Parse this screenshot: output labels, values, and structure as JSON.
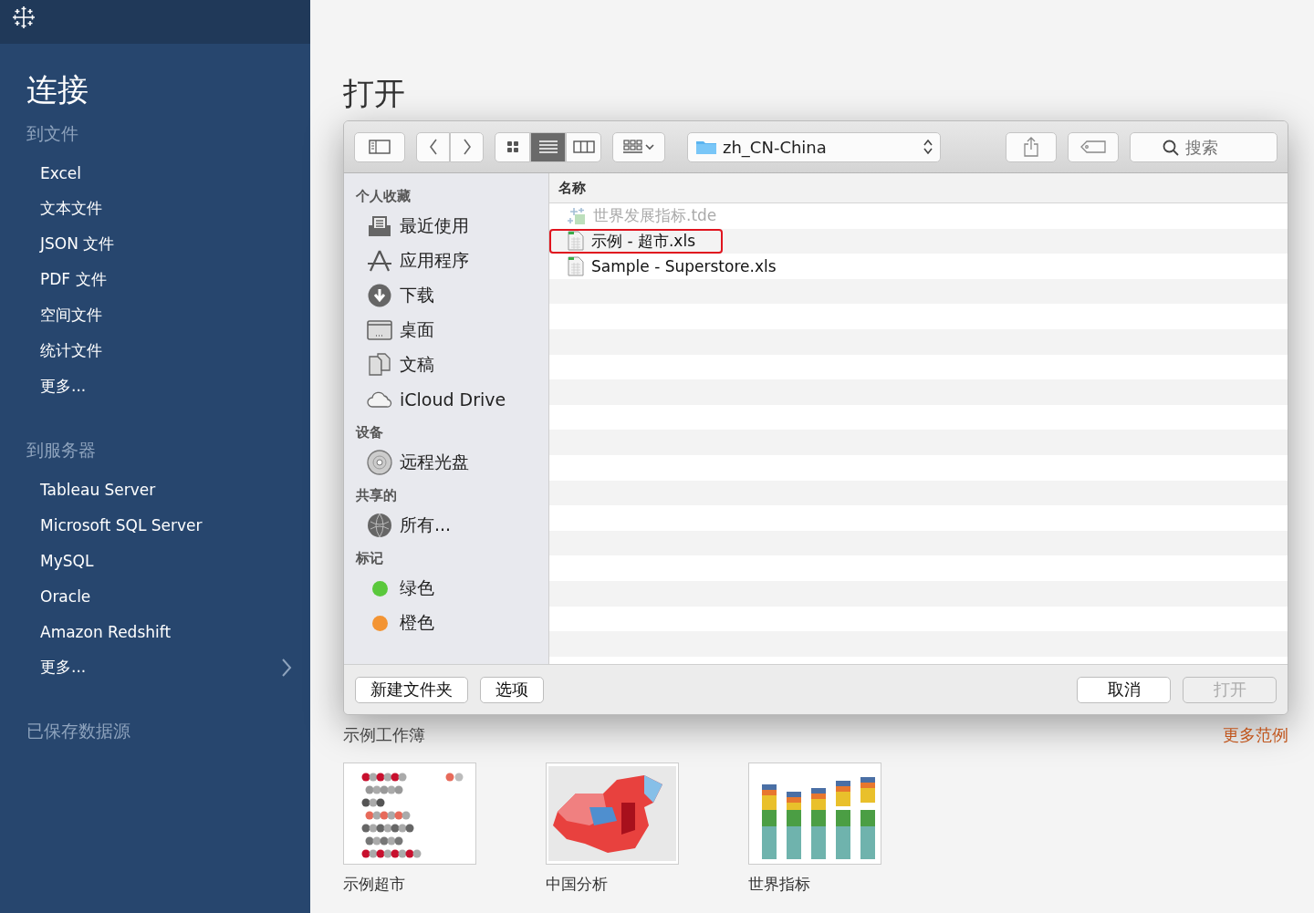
{
  "nav": {
    "heading": "连接",
    "sections": [
      {
        "title": "到文件",
        "items": [
          {
            "label": "Excel"
          },
          {
            "label": "文本文件"
          },
          {
            "label": "JSON 文件"
          },
          {
            "label": "PDF 文件"
          },
          {
            "label": "空间文件"
          },
          {
            "label": "统计文件"
          },
          {
            "label": "更多..."
          }
        ]
      },
      {
        "title": "到服务器",
        "items": [
          {
            "label": "Tableau Server"
          },
          {
            "label": "Microsoft SQL Server"
          },
          {
            "label": "MySQL"
          },
          {
            "label": "Oracle"
          },
          {
            "label": "Amazon Redshift"
          },
          {
            "label": "更多...",
            "chevron": true
          }
        ]
      },
      {
        "title": "已保存数据源"
      }
    ]
  },
  "page_title": "打开",
  "dialog": {
    "view_buttons": [
      {
        "selected": false
      },
      {
        "selected": true
      },
      {
        "selected": false
      }
    ],
    "location": "zh_CN-China",
    "search": {
      "placeholder": "搜索"
    },
    "sidebar": [
      {
        "title": "个人收藏",
        "items": [
          {
            "kind": "place",
            "label": "最近使用"
          },
          {
            "kind": "place",
            "label": "应用程序"
          },
          {
            "kind": "place",
            "label": "下载"
          },
          {
            "kind": "place",
            "label": "桌面"
          },
          {
            "kind": "place",
            "label": "文稿"
          },
          {
            "kind": "place",
            "label": "iCloud Drive"
          }
        ]
      },
      {
        "title": "设备",
        "items": [
          {
            "kind": "place",
            "label": "远程光盘"
          }
        ]
      },
      {
        "title": "共享的",
        "items": [
          {
            "kind": "place",
            "label": "所有..."
          }
        ]
      },
      {
        "title": "标记",
        "items": [
          {
            "kind": "tag",
            "label": "绿色",
            "color": "#5ac83c"
          },
          {
            "kind": "tag",
            "label": "橙色",
            "color": "#f39433"
          }
        ]
      }
    ],
    "column": "名称",
    "files": [
      {
        "name": "世界发展指标.tde",
        "kind": "extract",
        "disabled": true,
        "highlighted": false
      },
      {
        "name": "示例 - 超市.xls",
        "kind": "sheet",
        "disabled": false,
        "highlighted": true
      },
      {
        "name": "Sample - Superstore.xls",
        "kind": "sheet",
        "disabled": false,
        "highlighted": false
      }
    ],
    "buttons": [
      {
        "label": "新建文件夹",
        "disabled": false
      },
      {
        "label": "选项",
        "disabled": false
      }
    ],
    "actions": [
      {
        "label": "取消",
        "disabled": false
      },
      {
        "label": "打开",
        "disabled": true
      }
    ]
  },
  "workbooks": {
    "title": "示例工作簿",
    "more": "更多范例",
    "items": [
      {
        "kind": "dots",
        "label": "示例超市"
      },
      {
        "kind": "map",
        "label": "中国分析"
      },
      {
        "kind": "bars",
        "label": "世界指标"
      }
    ]
  }
}
